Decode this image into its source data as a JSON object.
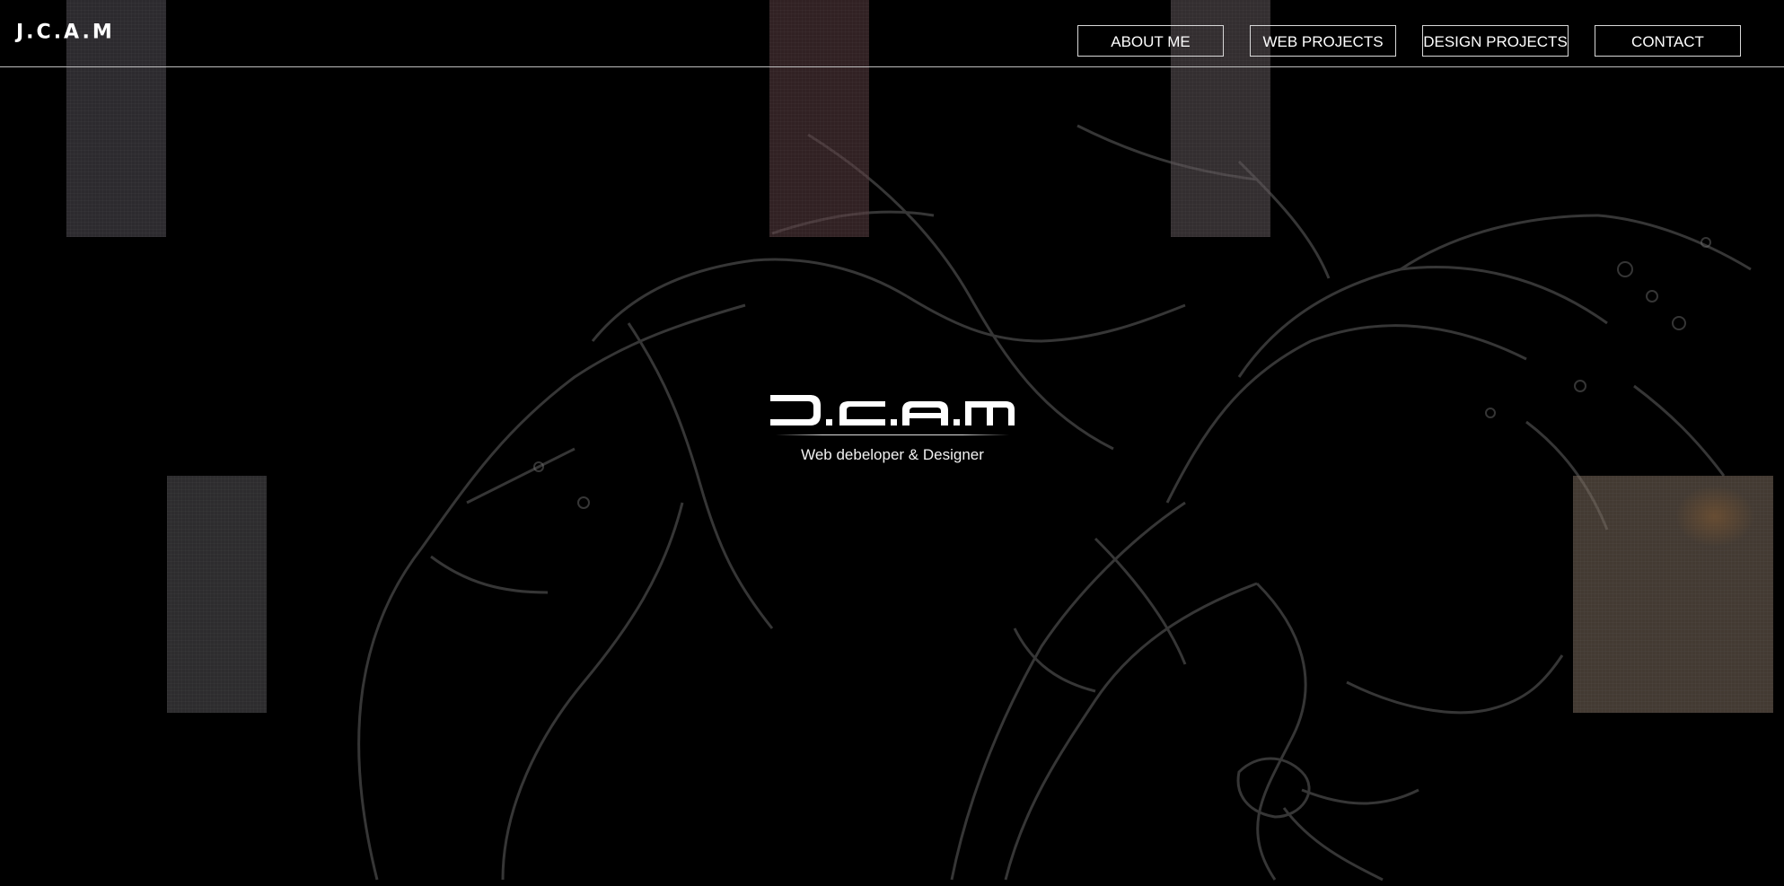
{
  "brand": {
    "logo_text": "J.C.A.M",
    "tagline": "Web debeloper & Designer"
  },
  "nav": {
    "items": [
      {
        "label": "ABOUT ME"
      },
      {
        "label": "WEB PROJECTS"
      },
      {
        "label": "DESIGN PROJECTS"
      },
      {
        "label": "CONTACT"
      }
    ]
  },
  "colors": {
    "background": "#000000",
    "foreground": "#ffffff",
    "border": "#d8d8d8"
  }
}
